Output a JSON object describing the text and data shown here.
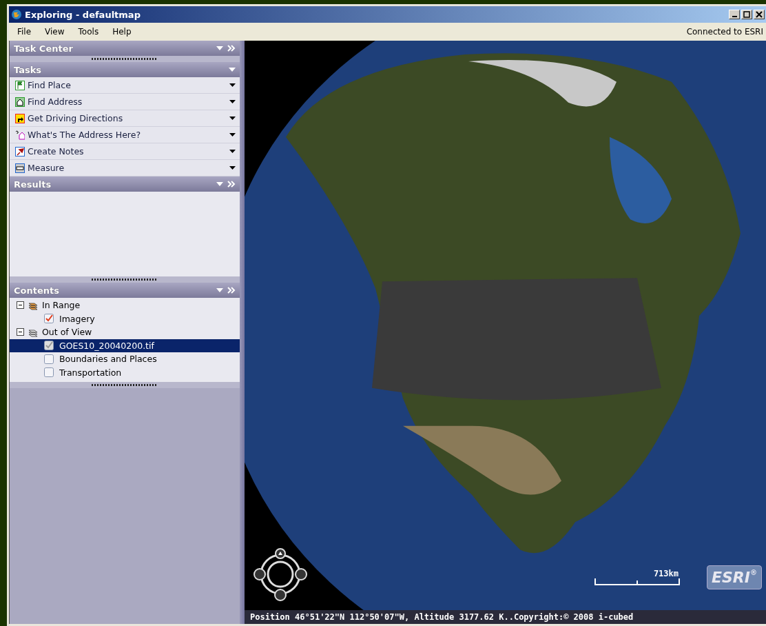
{
  "window": {
    "title": "Exploring - defaultmap"
  },
  "menu": [
    "File",
    "View",
    "Tools",
    "Help"
  ],
  "connection_status": "Connected to ESRI",
  "task_center": {
    "title": "Task Center"
  },
  "tasks": {
    "title": "Tasks",
    "items": [
      {
        "label": "Find Place",
        "kind": "flag"
      },
      {
        "label": "Find Address",
        "kind": "house"
      },
      {
        "label": "Get Driving Directions",
        "kind": "turn"
      },
      {
        "label": "What's The Address Here?",
        "kind": "query"
      },
      {
        "label": "Create Notes",
        "kind": "pin"
      },
      {
        "label": "Measure",
        "kind": "ruler"
      }
    ]
  },
  "results": {
    "title": "Results"
  },
  "contents": {
    "title": "Contents",
    "tree": [
      {
        "label": "In Range",
        "expanded": true,
        "children": [
          {
            "label": "Imagery",
            "checked": true,
            "selected": false
          }
        ]
      },
      {
        "label": "Out of View",
        "expanded": true,
        "children": [
          {
            "label": "GOES10_20040200.tif",
            "checked": true,
            "selected": true
          },
          {
            "label": "Boundaries and Places",
            "checked": false,
            "selected": false
          },
          {
            "label": "Transportation",
            "checked": false,
            "selected": false
          }
        ]
      }
    ]
  },
  "map": {
    "scale_label": "713km",
    "logo": "ESRI",
    "logo_mark": "®"
  },
  "status_bar": "Position 46°51'22\"N  112°50'07\"W, Altitude  3177.62 K..Copyright:© 2008 i-cubed"
}
